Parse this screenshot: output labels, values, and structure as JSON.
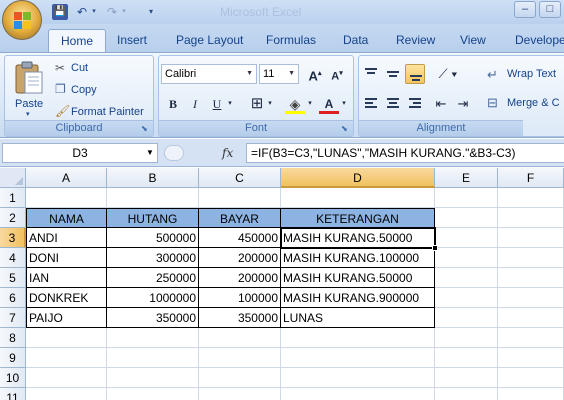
{
  "window": {
    "title": "Microsoft Excel"
  },
  "quick_access": {
    "save": "💾",
    "undo": "↶",
    "redo": "↷",
    "dd": "▾",
    "customize": "▾"
  },
  "window_buttons": {
    "minimize": "–",
    "maximize": "□"
  },
  "tabs": [
    {
      "label": "Home",
      "active": true
    },
    {
      "label": "Insert"
    },
    {
      "label": "Page Layout"
    },
    {
      "label": "Formulas"
    },
    {
      "label": "Data"
    },
    {
      "label": "Review"
    },
    {
      "label": "View"
    },
    {
      "label": "Develope"
    }
  ],
  "ribbon": {
    "clipboard": {
      "label": "Clipboard",
      "paste": "Paste",
      "cut": "Cut",
      "copy": "Copy",
      "format_painter": "Format Painter"
    },
    "font": {
      "label": "Font",
      "font_name": "Calibri",
      "font_size": "11",
      "grow": "A",
      "shrink": "A",
      "bold": "B",
      "italic": "I",
      "underline": "U",
      "font_color": "A"
    },
    "alignment": {
      "label": "Alignment",
      "wrap_text": "Wrap Text",
      "merge_center": "Merge & C"
    }
  },
  "formula_bar": {
    "name_box": "D3",
    "fx": "fx",
    "formula": "=IF(B3=C3,\"LUNAS\",\"MASIH KURANG.\"&B3-C3)"
  },
  "sheet": {
    "columns": [
      "A",
      "B",
      "C",
      "D",
      "E",
      "F"
    ],
    "rows": [
      "1",
      "2",
      "3",
      "4",
      "5",
      "6",
      "7",
      "8",
      "9",
      "10",
      "11"
    ],
    "active_cell": "D3",
    "header_fill": "#8db3e2",
    "table_header": [
      "NAMA",
      "HUTANG",
      "BAYAR",
      "KETERANGAN"
    ],
    "table_rows": [
      [
        "ANDI",
        "500000",
        "450000",
        "MASIH KURANG.50000"
      ],
      [
        "DONI",
        "300000",
        "200000",
        "MASIH KURANG.100000"
      ],
      [
        "IAN",
        "250000",
        "200000",
        "MASIH KURANG.50000"
      ],
      [
        "DONKREK",
        "1000000",
        "100000",
        "MASIH KURANG.900000"
      ],
      [
        "PAIJO",
        "350000",
        "350000",
        "LUNAS"
      ]
    ]
  }
}
